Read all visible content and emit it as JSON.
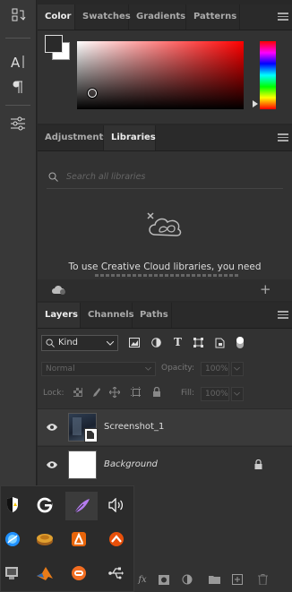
{
  "color_panel": {
    "tabs": [
      {
        "label": "Color"
      },
      {
        "label": "Swatches"
      },
      {
        "label": "Gradients"
      },
      {
        "label": "Patterns"
      }
    ],
    "foreground": "#2a2a2a",
    "background": "#ffffff"
  },
  "libraries_panel": {
    "tabs": [
      {
        "label": "Adjustments"
      },
      {
        "label": "Libraries"
      }
    ],
    "search_placeholder": "Search all libraries",
    "message": "To use Creative Cloud libraries, you need"
  },
  "layers_panel": {
    "tabs": [
      {
        "label": "Layers"
      },
      {
        "label": "Channels"
      },
      {
        "label": "Paths"
      }
    ],
    "filter_kind": "Kind",
    "blend_mode": "Normal",
    "opacity_label": "Opacity:",
    "opacity_value": "100%",
    "lock_label": "Lock:",
    "fill_label": "Fill:",
    "fill_value": "100%",
    "layers": [
      {
        "name": "Screenshot_1",
        "italic": false
      },
      {
        "name": "Background",
        "italic": true
      }
    ]
  },
  "tray": {
    "icons": [
      "shield-alert-icon",
      "google-icon",
      "feather-app-icon",
      "speaker-icon",
      "blue-app-icon",
      "coins-app-icon",
      "orange-slide-app-icon",
      "orange-up-icon",
      "monitor-icon",
      "matlab-icon",
      "orange-circle-app-icon",
      "usb-icon"
    ]
  },
  "layers_footer": {
    "fx": "fx"
  }
}
